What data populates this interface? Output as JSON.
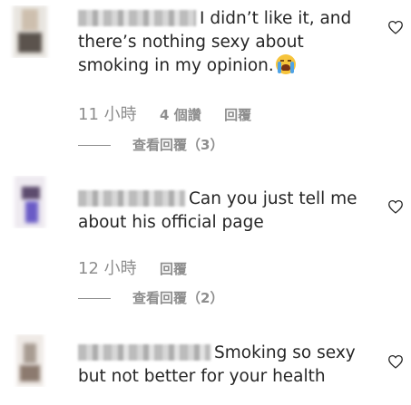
{
  "comments": [
    {
      "text": "I didn’t like it, and there’s nothing sexy about smoking in my opinion.",
      "emoji": "loudly-crying-face-emoji",
      "time": "11 小時",
      "likes": "4 個讚",
      "reply_label": "回覆",
      "view_replies": "查看回覆（3）",
      "heart_icon": "heart-icon"
    },
    {
      "text": "Can you just tell me about his official page",
      "time": "12 小時",
      "reply_label": "回覆",
      "view_replies": "查看回覆（2）",
      "heart_icon": "heart-icon"
    },
    {
      "text": "Smoking so sexy but not better for your health",
      "heart_icon": "heart-icon"
    }
  ],
  "colors": {
    "text": "#262626",
    "secondary": "#8e8e8e",
    "background": "#ffffff"
  }
}
